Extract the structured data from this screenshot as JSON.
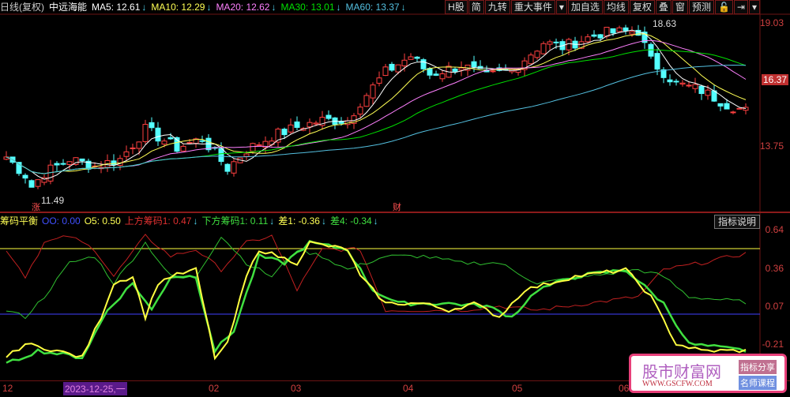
{
  "header": {
    "period": "日线(复权)",
    "stock": "中远海能",
    "ma5": "MA5: 12.61",
    "ma10": "MA10: 12.29",
    "ma20": "MA20: 12.62",
    "ma30": "MA30: 13.01",
    "ma60": "MA60: 13.37",
    "arrow": "↓"
  },
  "toolbar": [
    "H股",
    "简",
    "九转",
    "重大事件",
    "▾",
    "加自选",
    "均线",
    "复权",
    "叠",
    "窗",
    "预测",
    "🔓",
    "⇥",
    "▾"
  ],
  "price_axis": [
    "19.03",
    "16.37",
    "13.75"
  ],
  "price_marks": {
    "high": "18.63",
    "low": "11.49",
    "zhang": "涨",
    "cai": "财"
  },
  "indicator": {
    "name": "筹码平衡",
    "oo": "OO: 0.00",
    "o5": "O5: 0.50",
    "up": "上方筹码1: 0.47",
    "down": "下方筹码1: 0.11",
    "d1": "差1: -0.36",
    "d4": "差4: -0.34",
    "explain": "指标说明",
    "axis": [
      "0.64",
      "0.36",
      "0.07",
      "-0.21"
    ]
  },
  "xaxis": {
    "labels": [
      "12",
      "2023-12-25,一",
      "02",
      "03",
      "04",
      "05",
      "06"
    ]
  },
  "watermark": {
    "title": "股市财富网",
    "url": "WWW.GSCFW.COM",
    "b1": "指标分享",
    "b2": "名师课程"
  },
  "colors": {
    "up": "#ff4040",
    "down": "#54ffff",
    "ma5": "#ffffff",
    "ma10": "#ffff54",
    "ma20": "#ff80ff",
    "ma30": "#00e000",
    "ma60": "#54c0e0"
  },
  "chart_data": {
    "type": "candlestick",
    "price_keypoints": [
      [
        0,
        13.0
      ],
      [
        3,
        12.2
      ],
      [
        4,
        11.7
      ],
      [
        6,
        12.3
      ],
      [
        10,
        12.9
      ],
      [
        14,
        12.6
      ],
      [
        18,
        12.9
      ],
      [
        22,
        14.2
      ],
      [
        27,
        13.4
      ],
      [
        31,
        13.8
      ],
      [
        35,
        12.5
      ],
      [
        38,
        13.3
      ],
      [
        42,
        13.9
      ],
      [
        46,
        14.3
      ],
      [
        50,
        14.6
      ],
      [
        54,
        14.6
      ],
      [
        56,
        15.4
      ],
      [
        60,
        16.7
      ],
      [
        64,
        17.4
      ],
      [
        67,
        16.6
      ],
      [
        72,
        17.0
      ],
      [
        76,
        16.5
      ],
      [
        80,
        16.8
      ],
      [
        85,
        18.0
      ],
      [
        88,
        17.8
      ],
      [
        94,
        18.4
      ],
      [
        100,
        18.5
      ],
      [
        102,
        17.2
      ],
      [
        106,
        16.2
      ],
      [
        110,
        15.9
      ],
      [
        114,
        15.3
      ],
      [
        117,
        15.0
      ]
    ],
    "ind_yellow": [
      [
        0,
        -0.3
      ],
      [
        3,
        -0.2
      ],
      [
        8,
        -0.25
      ],
      [
        12,
        -0.3
      ],
      [
        15,
        0.0
      ],
      [
        17,
        0.25
      ],
      [
        20,
        0.3
      ],
      [
        22,
        0.0
      ],
      [
        24,
        0.25
      ],
      [
        26,
        0.3
      ],
      [
        30,
        0.35
      ],
      [
        33,
        -0.3
      ],
      [
        35,
        -0.2
      ],
      [
        38,
        0.3
      ],
      [
        40,
        0.5
      ],
      [
        43,
        0.45
      ],
      [
        46,
        0.4
      ],
      [
        48,
        0.55
      ],
      [
        54,
        0.5
      ],
      [
        56,
        0.3
      ],
      [
        60,
        0.1
      ],
      [
        66,
        0.1
      ],
      [
        70,
        0.05
      ],
      [
        74,
        0.1
      ],
      [
        78,
        0.0
      ],
      [
        82,
        0.2
      ],
      [
        86,
        0.25
      ],
      [
        90,
        0.3
      ],
      [
        98,
        0.35
      ],
      [
        102,
        0.15
      ],
      [
        106,
        -0.2
      ],
      [
        110,
        -0.25
      ],
      [
        117,
        -0.25
      ]
    ],
    "ind_green": [
      [
        0,
        -0.35
      ],
      [
        5,
        -0.25
      ],
      [
        12,
        -0.3
      ],
      [
        16,
        0.05
      ],
      [
        20,
        0.25
      ],
      [
        23,
        0.05
      ],
      [
        26,
        0.3
      ],
      [
        30,
        0.3
      ],
      [
        33,
        -0.25
      ],
      [
        36,
        -0.1
      ],
      [
        40,
        0.45
      ],
      [
        44,
        0.4
      ],
      [
        48,
        0.55
      ],
      [
        54,
        0.5
      ],
      [
        58,
        0.2
      ],
      [
        62,
        0.1
      ],
      [
        70,
        0.1
      ],
      [
        76,
        0.08
      ],
      [
        80,
        0.0
      ],
      [
        84,
        0.2
      ],
      [
        90,
        0.3
      ],
      [
        98,
        0.35
      ],
      [
        104,
        0.1
      ],
      [
        108,
        -0.2
      ],
      [
        117,
        -0.25
      ]
    ],
    "ind_red": [
      [
        0,
        0.5
      ],
      [
        3,
        0.3
      ],
      [
        6,
        0.55
      ],
      [
        10,
        0.6
      ],
      [
        14,
        0.5
      ],
      [
        17,
        0.3
      ],
      [
        22,
        0.6
      ],
      [
        26,
        0.45
      ],
      [
        30,
        0.5
      ],
      [
        34,
        0.35
      ],
      [
        38,
        0.55
      ],
      [
        42,
        0.6
      ],
      [
        46,
        0.2
      ],
      [
        50,
        0.5
      ],
      [
        56,
        0.5
      ],
      [
        60,
        0.05
      ],
      [
        66,
        0.05
      ],
      [
        72,
        0.05
      ],
      [
        78,
        0.08
      ],
      [
        84,
        0.05
      ],
      [
        92,
        0.1
      ],
      [
        100,
        0.15
      ],
      [
        104,
        0.35
      ],
      [
        110,
        0.4
      ],
      [
        117,
        0.47
      ]
    ],
    "ind_lgreen": [
      [
        0,
        0.05
      ],
      [
        3,
        0.0
      ],
      [
        6,
        0.15
      ],
      [
        10,
        0.4
      ],
      [
        14,
        0.45
      ],
      [
        17,
        0.25
      ],
      [
        22,
        0.55
      ],
      [
        26,
        0.3
      ],
      [
        30,
        0.3
      ],
      [
        34,
        0.6
      ],
      [
        38,
        0.4
      ],
      [
        42,
        0.3
      ],
      [
        46,
        0.5
      ],
      [
        50,
        0.45
      ],
      [
        54,
        0.35
      ],
      [
        60,
        0.45
      ],
      [
        66,
        0.45
      ],
      [
        72,
        0.4
      ],
      [
        78,
        0.4
      ],
      [
        84,
        0.25
      ],
      [
        92,
        0.3
      ],
      [
        100,
        0.35
      ],
      [
        104,
        0.3
      ],
      [
        108,
        0.15
      ],
      [
        117,
        0.11
      ]
    ]
  }
}
